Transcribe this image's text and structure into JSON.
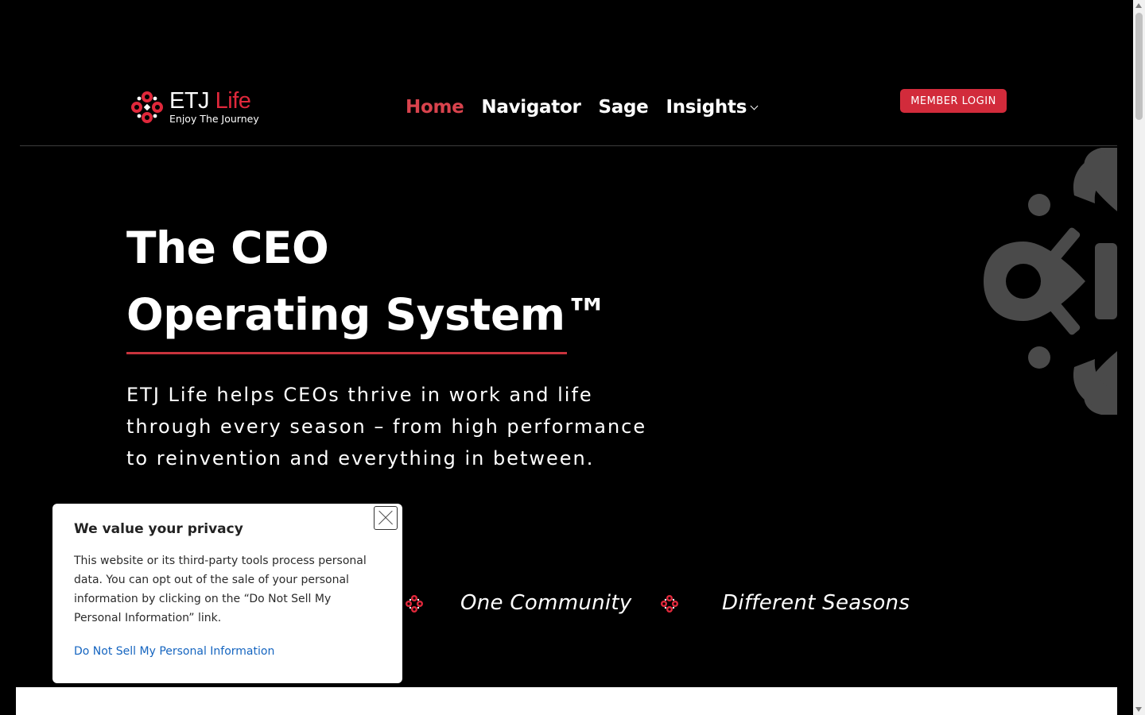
{
  "header": {
    "logo": {
      "brand_first": "ETJ",
      "brand_second": "Life",
      "tagline": "Enjoy The Journey"
    },
    "nav": [
      {
        "label": "Home",
        "active": true
      },
      {
        "label": "Navigator",
        "active": false
      },
      {
        "label": "Sage",
        "active": false
      },
      {
        "label": "Insights",
        "active": false,
        "has_dropdown": true
      }
    ],
    "login_label": "MEMBER LOGIN"
  },
  "hero": {
    "title_line1": "The CEO",
    "title_line2": "Operating System™",
    "description": "ETJ Life helps CEOs thrive in work and life through every season – from high performance to reinvention and everything in between."
  },
  "taglines": [
    "One Community",
    "Different Seasons"
  ],
  "cookie": {
    "title": "We value your privacy",
    "body": "This website or its third-party tools process personal data. You can opt out of the sale of your personal information by clicking on the “Do Not Sell My Personal Information” link.",
    "link": "Do Not Sell My Personal Information",
    "close_icon": "close-icon"
  },
  "colors": {
    "accent": "#d22b3b",
    "active_nav": "#d9434d",
    "link": "#1565c0",
    "background": "#000000"
  }
}
